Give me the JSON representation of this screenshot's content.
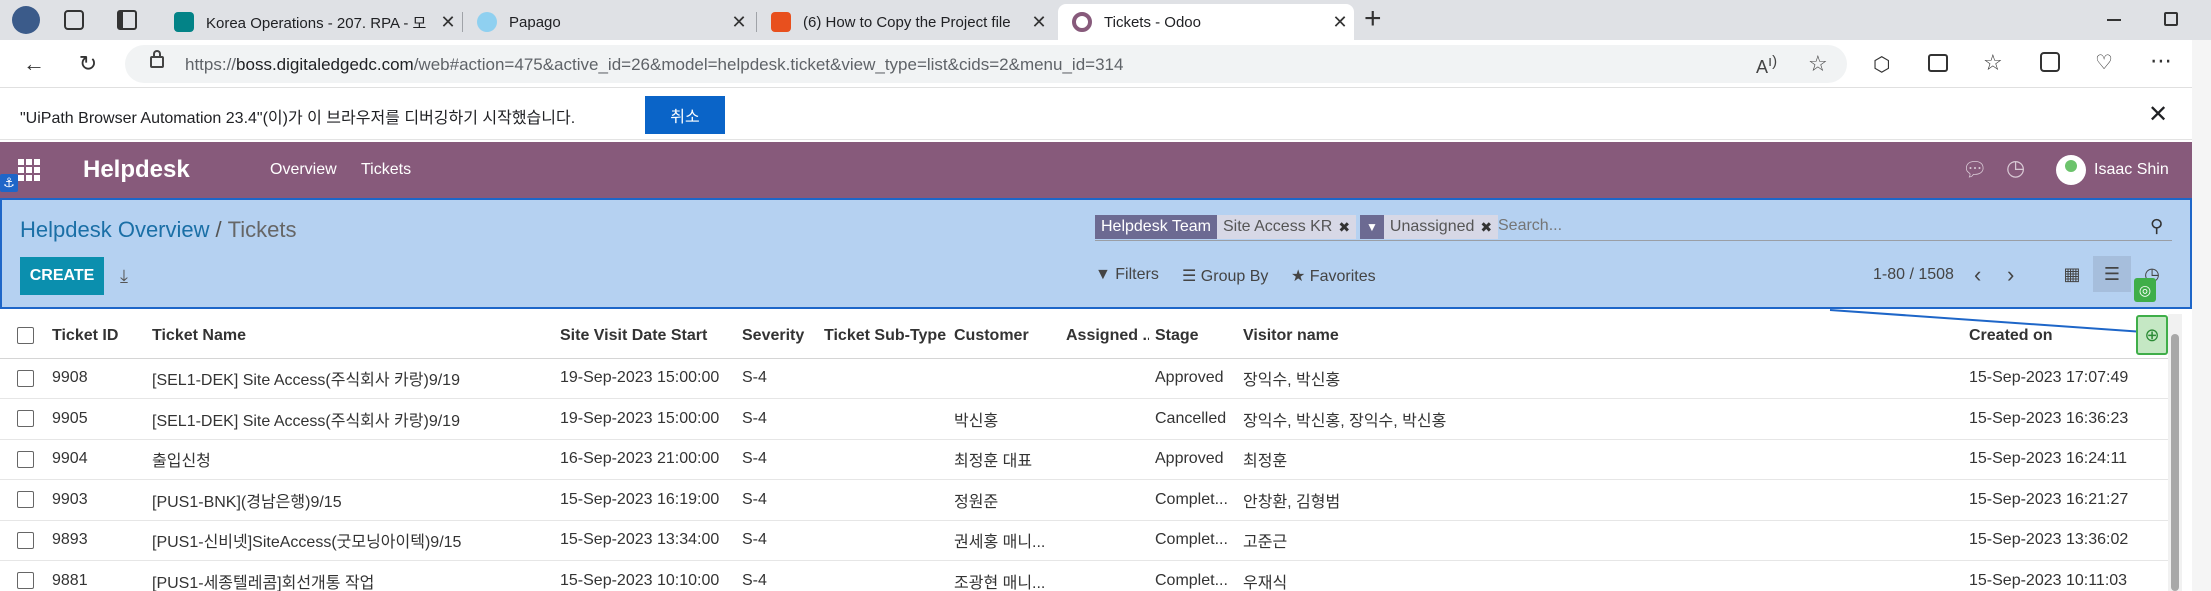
{
  "browser": {
    "tabs": [
      {
        "title": "Korea Operations - 207. RPA - 모",
        "favicon_color": "#038387"
      },
      {
        "title": "Papago",
        "favicon_color": "#2db400"
      },
      {
        "title": "(6) How to Copy the Project file",
        "favicon_color": "#e8501e"
      },
      {
        "title": "Tickets - Odoo",
        "favicon_color": "#875a7b"
      }
    ],
    "new_tab": "+",
    "url_prefix": "https://",
    "url_host": "boss.digitaledgedc.com",
    "url_path": "/web#action=475&active_id=26&model=helpdesk.ticket&view_type=list&cids=2&menu_id=314"
  },
  "infobar": {
    "message": "\"UiPath Browser Automation 23.4\"(이)가 이 브라우저를 디버깅하기 시작했습니다.",
    "cancel_label": "취소"
  },
  "odoo": {
    "brand": "Helpdesk",
    "menu": [
      "Overview",
      "Tickets"
    ],
    "user": "Isaac Shin",
    "brand_color": "#875a7b"
  },
  "control_panel": {
    "breadcrumb_parent": "Helpdesk Overview",
    "breadcrumb_sep": "/",
    "breadcrumb_current": "Tickets",
    "facets": [
      {
        "label": "Helpdesk Team",
        "value": "Site Access KR"
      },
      {
        "label": "▼",
        "value": "Unassigned"
      }
    ],
    "search_placeholder": "Search...",
    "create_label": "CREATE",
    "filters_label": "Filters",
    "groupby_label": "Group By",
    "favorites_label": "Favorites",
    "pager": "1-80 / 1508"
  },
  "table": {
    "columns": [
      "Ticket ID",
      "Ticket Name",
      "Site Visit Date Start",
      "Severity",
      "Ticket Sub-Type",
      "Customer",
      "Assigned ...",
      "Stage",
      "Visitor name",
      "Created on"
    ],
    "rows": [
      [
        "9908",
        "[SEL1-DEK] Site Access(주식회사 카랑)9/19",
        "19-Sep-2023 15:00:00",
        "S-4",
        "",
        "",
        "",
        "Approved",
        "장익수, 박신홍",
        "15-Sep-2023 17:07:49"
      ],
      [
        "9905",
        "[SEL1-DEK] Site Access(주식회사 카랑)9/19",
        "19-Sep-2023 15:00:00",
        "S-4",
        "",
        "박신홍",
        "",
        "Cancelled",
        "장익수, 박신홍, 장익수, 박신홍",
        "15-Sep-2023 16:36:23"
      ],
      [
        "9904",
        "출입신청",
        "16-Sep-2023 21:00:00",
        "S-4",
        "",
        "최정훈 대표",
        "",
        "Approved",
        "최정훈",
        "15-Sep-2023 16:24:11"
      ],
      [
        "9903",
        "[PUS1-BNK](경남은행)9/15",
        "15-Sep-2023 16:19:00",
        "S-4",
        "",
        "정원준",
        "",
        "Complet...",
        "안창환, 김형범",
        "15-Sep-2023 16:21:27"
      ],
      [
        "9893",
        "[PUS1-신비넷]SiteAccess(굿모닝아이텍)9/15",
        "15-Sep-2023 13:34:00",
        "S-4",
        "",
        "권세홍 매니...",
        "",
        "Complet...",
        "고준근",
        "15-Sep-2023 13:36:02"
      ],
      [
        "9881",
        "[PUS1-세종텔레콤]회선개통 작업",
        "15-Sep-2023 10:10:00",
        "S-4",
        "",
        "조광현 매니...",
        "",
        "Complet...",
        "우재식",
        "15-Sep-2023 10:11:03"
      ]
    ]
  }
}
